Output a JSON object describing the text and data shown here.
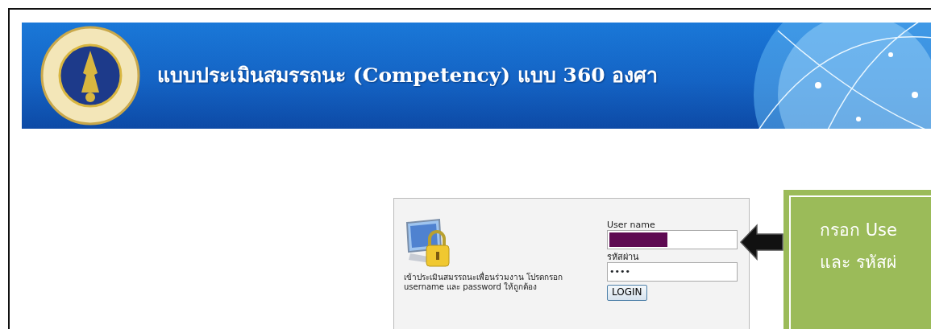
{
  "banner": {
    "title": "แบบประเมินสมรรถนะ (Competency) แบบ 360 องศา"
  },
  "login": {
    "description": "เข้าประเมินสมรรถนะเพื่อนร่วมงาน โปรดกรอก username และ password ให้ถูกต้อง",
    "username_label": "User name",
    "username_redacted": true,
    "password_label": "รหัสผ่าน",
    "password_value": "••••",
    "button": "LOGIN"
  },
  "callout": {
    "lines": [
      "กรอก Use",
      "และ รหัสผ่"
    ]
  }
}
